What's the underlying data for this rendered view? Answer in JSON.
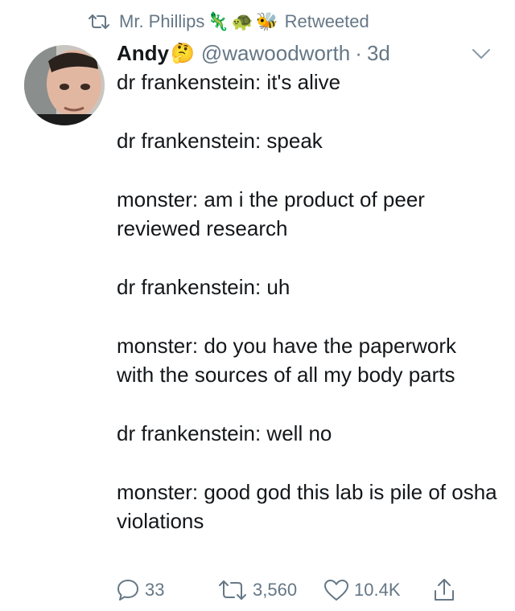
{
  "retweet_context": {
    "retweeter_name": "Mr. Phillips",
    "retweeter_emojis": [
      "🦎",
      "🐢",
      "🐝"
    ],
    "label": "Retweeted"
  },
  "tweet": {
    "author_name": "Andy",
    "author_emoji": "🤔",
    "handle": "@wawoodworth",
    "separator": "·",
    "age": "3d",
    "body_paragraphs": [
      "dr frankenstein: it's alive",
      "dr frankenstein: speak",
      "monster: am i the product of peer reviewed research",
      "dr frankenstein: uh",
      "monster: do you have the paperwork with the sources of all my body parts",
      "dr frankenstein: well no",
      "monster: good god this lab is pile of osha violations"
    ]
  },
  "actions": {
    "replies": "33",
    "retweets": "3,560",
    "likes": "10.4K"
  },
  "colors": {
    "text_primary": "#14171a",
    "text_secondary": "#657786"
  },
  "icons": [
    "retweet-icon",
    "avatar",
    "chevron-down-icon",
    "reply-icon",
    "retweet-icon",
    "heart-icon",
    "share-icon"
  ]
}
